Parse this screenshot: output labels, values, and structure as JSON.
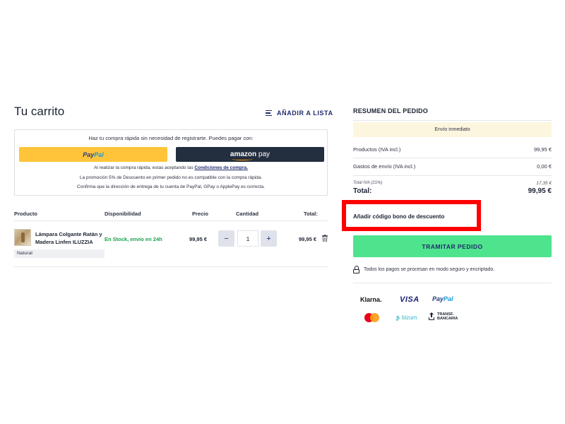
{
  "cart": {
    "title": "Tu carrito",
    "add_to_list": "AÑADIR A LISTA",
    "quick_buy": {
      "intro": "Haz tu compra rápida sin necesidad de registrarte. Puedes pagar con:",
      "paypal_logo_a": "Pay",
      "paypal_logo_b": "Pal",
      "amazon_logo": "amazon",
      "amazon_pay": " pay",
      "terms_prefix": "Al realizar la compra rápida, estas aceptando las ",
      "terms_link": "Condiciones de compra.",
      "promo_note": "La promoción 5% de Descuento en primer pedido no es compatible con la compra rápida.",
      "address_note": "Confirma que la dirección de entrega de tu cuenta de PayPal, GPay o ApplePay es correcta."
    },
    "table": {
      "headers": {
        "product": "Producto",
        "availability": "Disponibilidad",
        "price": "Precio",
        "quantity": "Cantidad",
        "total": "Total:"
      },
      "rows": [
        {
          "name": "Lámpara Colgante Ratán y Madera Linfen ILUZZIA",
          "variant": "Natural",
          "availability": "En Stock, envío en 24h",
          "price": "99,95 €",
          "quantity": "1",
          "decrement": "−",
          "increment": "+",
          "total": "99,95 €"
        }
      ]
    }
  },
  "summary": {
    "title": "RESUMEN DEL PEDIDO",
    "shipping_banner": "Envío inmediato",
    "products_label": "Productos (IVA incl.)",
    "products_value": "99,95 €",
    "shipping_label": "Gastos de envío (IVA incl.)",
    "shipping_value": "0,00 €",
    "iva_label": "Total IVA (21%)",
    "iva_value": "17,35 €",
    "total_label": "Total:",
    "total_value": "99,95 €",
    "discount_link": "Añadir código bono de descuento",
    "checkout_button": "TRAMITAR PEDIDO",
    "secure_text": "Todos los pagos se procesan en modo seguro y encriptado.",
    "payment_logos": {
      "klarna": "Klarna.",
      "visa": "VISA",
      "paypal_a": "Pay",
      "paypal_b": "Pal",
      "bizum": "bizum",
      "transfer_line1": "TRANSF.",
      "transfer_line2": "BANCARIA"
    }
  },
  "colors": {
    "navy": "#1f2a6b",
    "paypal_yellow": "#ffc439",
    "amazon_dark": "#232f3e",
    "stock_green": "#19a34a",
    "checkout_green": "#4ee38d",
    "banner_cream": "#fdf6df",
    "highlight_red": "#ff0000"
  },
  "icons": [
    "list-icon",
    "trash-icon",
    "lock-icon",
    "mastercard-icon",
    "bizum-icon",
    "upload-icon"
  ]
}
